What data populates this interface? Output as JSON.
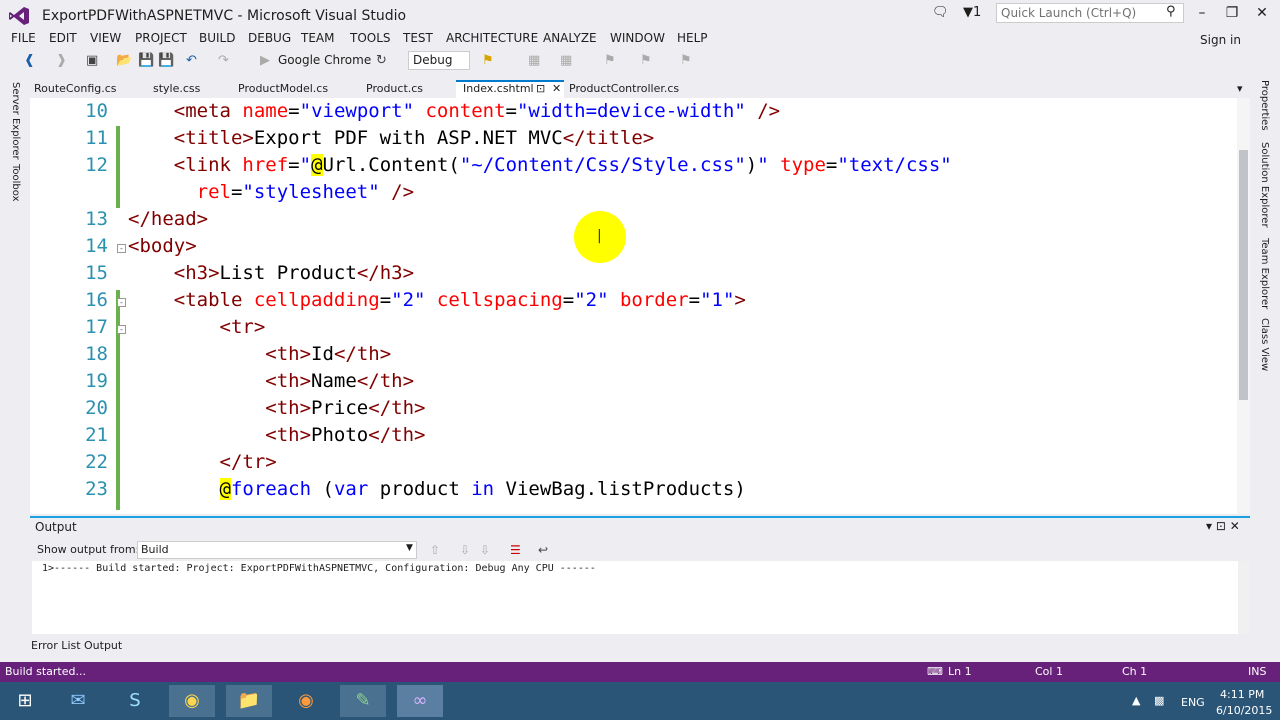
{
  "window": {
    "title": "ExportPDFWithASPNETMVC - Microsoft Visual Studio",
    "notification_count": "1",
    "quick_launch_placeholder": "Quick Launch (Ctrl+Q)"
  },
  "menu": [
    "FILE",
    "EDIT",
    "VIEW",
    "PROJECT",
    "BUILD",
    "DEBUG",
    "TEAM",
    "TOOLS",
    "TEST",
    "ARCHITECTURE",
    "ANALYZE",
    "WINDOW",
    "HELP"
  ],
  "sign_in": "Sign in",
  "toolbar": {
    "browser": "Google Chrome",
    "configuration": "Debug"
  },
  "tabs": [
    "RouteConfig.cs",
    "style.css",
    "ProductModel.cs",
    "Product.cs",
    "Index.cshtml",
    "ProductController.cs"
  ],
  "active_tab": "Index.cshtml",
  "left_panels": [
    "Server Explorer",
    "Toolbox"
  ],
  "right_panels": [
    "Properties",
    "Solution Explorer",
    "Team Explorer",
    "Class View"
  ],
  "editor": {
    "lines": [
      {
        "n": "10",
        "segs": [
          [
            "",
            "    "
          ],
          [
            "t",
            "<meta"
          ],
          [
            "",
            ""
          ],
          [
            "a",
            " name"
          ],
          [
            "",
            "="
          ],
          [
            "v",
            "\"viewport\""
          ],
          [
            "a",
            " content"
          ],
          [
            "",
            "="
          ],
          [
            "v",
            "\"width=device-width\""
          ],
          [
            "t",
            " />"
          ]
        ]
      },
      {
        "n": "11",
        "segs": [
          [
            "",
            "    "
          ],
          [
            "t",
            "<title>"
          ],
          [
            "",
            "Export PDF with ASP.NET MVC"
          ],
          [
            "t",
            "</title>"
          ]
        ]
      },
      {
        "n": "12",
        "segs": [
          [
            "",
            "    "
          ],
          [
            "t",
            "<link"
          ],
          [
            "a",
            " href"
          ],
          [
            "",
            "="
          ],
          [
            "v",
            "\""
          ],
          [
            "r",
            "@"
          ],
          [
            "",
            "Url.Content("
          ],
          [
            "v",
            "\"~/Content/Css/Style.css\""
          ],
          [
            "",
            ")"
          ],
          [
            "v",
            "\""
          ],
          [
            "a",
            " type"
          ],
          [
            "",
            "="
          ],
          [
            "v",
            "\"text/css\""
          ]
        ]
      },
      {
        "n": "",
        "segs": [
          [
            "",
            "      "
          ],
          [
            "a",
            "rel"
          ],
          [
            "",
            "="
          ],
          [
            "v",
            "\"stylesheet\""
          ],
          [
            "t",
            " />"
          ]
        ]
      },
      {
        "n": "13",
        "segs": [
          [
            "t",
            "</head>"
          ]
        ]
      },
      {
        "n": "14",
        "segs": [
          [
            "t",
            "<body>"
          ]
        ]
      },
      {
        "n": "15",
        "segs": [
          [
            "",
            "    "
          ],
          [
            "t",
            "<h3>"
          ],
          [
            "",
            "List Product"
          ],
          [
            "t",
            "</h3>"
          ]
        ]
      },
      {
        "n": "16",
        "segs": [
          [
            "",
            "    "
          ],
          [
            "t",
            "<table"
          ],
          [
            "a",
            " cellpadding"
          ],
          [
            "",
            "="
          ],
          [
            "v",
            "\"2\""
          ],
          [
            "a",
            " cellspacing"
          ],
          [
            "",
            "="
          ],
          [
            "v",
            "\"2\""
          ],
          [
            "a",
            " border"
          ],
          [
            "",
            "="
          ],
          [
            "v",
            "\"1\""
          ],
          [
            "t",
            ">"
          ]
        ]
      },
      {
        "n": "17",
        "segs": [
          [
            "",
            "        "
          ],
          [
            "t",
            "<tr>"
          ]
        ]
      },
      {
        "n": "18",
        "segs": [
          [
            "",
            "            "
          ],
          [
            "t",
            "<th>"
          ],
          [
            "",
            "Id"
          ],
          [
            "t",
            "</th>"
          ]
        ]
      },
      {
        "n": "19",
        "segs": [
          [
            "",
            "            "
          ],
          [
            "t",
            "<th>"
          ],
          [
            "",
            "Name"
          ],
          [
            "t",
            "</th>"
          ]
        ]
      },
      {
        "n": "20",
        "segs": [
          [
            "",
            "            "
          ],
          [
            "t",
            "<th>"
          ],
          [
            "",
            "Price"
          ],
          [
            "t",
            "</th>"
          ]
        ]
      },
      {
        "n": "21",
        "segs": [
          [
            "",
            "            "
          ],
          [
            "t",
            "<th>"
          ],
          [
            "",
            "Photo"
          ],
          [
            "t",
            "</th>"
          ]
        ]
      },
      {
        "n": "22",
        "segs": [
          [
            "",
            "        "
          ],
          [
            "t",
            "</tr>"
          ]
        ]
      },
      {
        "n": "23",
        "segs": [
          [
            "",
            "        "
          ],
          [
            "r",
            "@"
          ],
          [
            "k",
            "foreach"
          ],
          [
            "",
            " ("
          ],
          [
            "k",
            "var"
          ],
          [
            "",
            " product "
          ],
          [
            "k",
            "in"
          ],
          [
            "",
            " ViewBag.listProducts)"
          ]
        ]
      }
    ]
  },
  "output": {
    "title": "Output",
    "show_from_label": "Show output from:",
    "source": "Build",
    "text": "1>------ Build started: Project: ExportPDFWithASPNETMVC, Configuration: Debug Any CPU ------"
  },
  "bottom_tabs": [
    "Error List",
    "Output"
  ],
  "status": {
    "message": "Build started...",
    "ln": "Ln 1",
    "col": "Col 1",
    "ch": "Ch 1",
    "mode": "INS"
  },
  "tray": {
    "lang": "ENG",
    "time": "4:11 PM",
    "date": "6/10/2015"
  },
  "colors": {
    "status_bar": "#68217a",
    "taskbar": "#2b5576",
    "accent": "#007acc"
  }
}
